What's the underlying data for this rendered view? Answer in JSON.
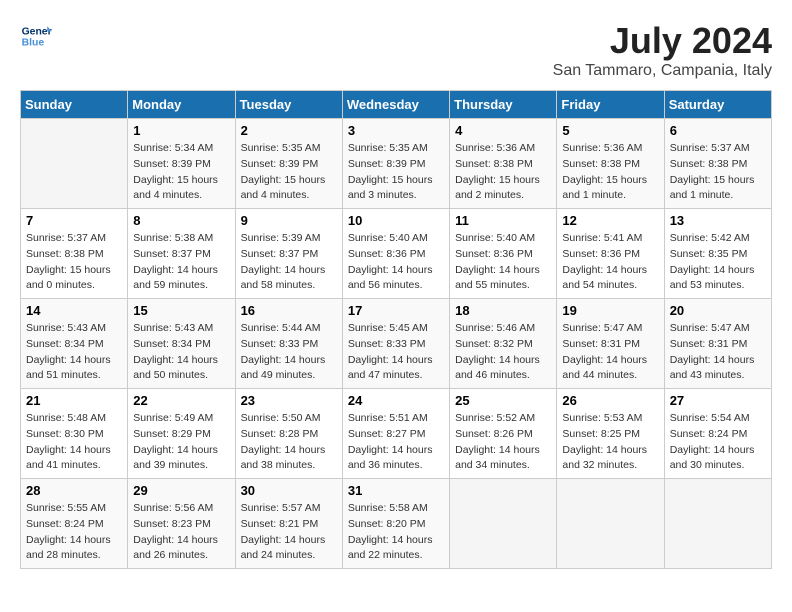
{
  "logo": {
    "line1": "General",
    "line2": "Blue"
  },
  "title": "July 2024",
  "location": "San Tammaro, Campania, Italy",
  "weekdays": [
    "Sunday",
    "Monday",
    "Tuesday",
    "Wednesday",
    "Thursday",
    "Friday",
    "Saturday"
  ],
  "weeks": [
    [
      {
        "day": "",
        "info": ""
      },
      {
        "day": "1",
        "info": "Sunrise: 5:34 AM\nSunset: 8:39 PM\nDaylight: 15 hours\nand 4 minutes."
      },
      {
        "day": "2",
        "info": "Sunrise: 5:35 AM\nSunset: 8:39 PM\nDaylight: 15 hours\nand 4 minutes."
      },
      {
        "day": "3",
        "info": "Sunrise: 5:35 AM\nSunset: 8:39 PM\nDaylight: 15 hours\nand 3 minutes."
      },
      {
        "day": "4",
        "info": "Sunrise: 5:36 AM\nSunset: 8:38 PM\nDaylight: 15 hours\nand 2 minutes."
      },
      {
        "day": "5",
        "info": "Sunrise: 5:36 AM\nSunset: 8:38 PM\nDaylight: 15 hours\nand 1 minute."
      },
      {
        "day": "6",
        "info": "Sunrise: 5:37 AM\nSunset: 8:38 PM\nDaylight: 15 hours\nand 1 minute."
      }
    ],
    [
      {
        "day": "7",
        "info": "Sunrise: 5:37 AM\nSunset: 8:38 PM\nDaylight: 15 hours\nand 0 minutes."
      },
      {
        "day": "8",
        "info": "Sunrise: 5:38 AM\nSunset: 8:37 PM\nDaylight: 14 hours\nand 59 minutes."
      },
      {
        "day": "9",
        "info": "Sunrise: 5:39 AM\nSunset: 8:37 PM\nDaylight: 14 hours\nand 58 minutes."
      },
      {
        "day": "10",
        "info": "Sunrise: 5:40 AM\nSunset: 8:36 PM\nDaylight: 14 hours\nand 56 minutes."
      },
      {
        "day": "11",
        "info": "Sunrise: 5:40 AM\nSunset: 8:36 PM\nDaylight: 14 hours\nand 55 minutes."
      },
      {
        "day": "12",
        "info": "Sunrise: 5:41 AM\nSunset: 8:36 PM\nDaylight: 14 hours\nand 54 minutes."
      },
      {
        "day": "13",
        "info": "Sunrise: 5:42 AM\nSunset: 8:35 PM\nDaylight: 14 hours\nand 53 minutes."
      }
    ],
    [
      {
        "day": "14",
        "info": "Sunrise: 5:43 AM\nSunset: 8:34 PM\nDaylight: 14 hours\nand 51 minutes."
      },
      {
        "day": "15",
        "info": "Sunrise: 5:43 AM\nSunset: 8:34 PM\nDaylight: 14 hours\nand 50 minutes."
      },
      {
        "day": "16",
        "info": "Sunrise: 5:44 AM\nSunset: 8:33 PM\nDaylight: 14 hours\nand 49 minutes."
      },
      {
        "day": "17",
        "info": "Sunrise: 5:45 AM\nSunset: 8:33 PM\nDaylight: 14 hours\nand 47 minutes."
      },
      {
        "day": "18",
        "info": "Sunrise: 5:46 AM\nSunset: 8:32 PM\nDaylight: 14 hours\nand 46 minutes."
      },
      {
        "day": "19",
        "info": "Sunrise: 5:47 AM\nSunset: 8:31 PM\nDaylight: 14 hours\nand 44 minutes."
      },
      {
        "day": "20",
        "info": "Sunrise: 5:47 AM\nSunset: 8:31 PM\nDaylight: 14 hours\nand 43 minutes."
      }
    ],
    [
      {
        "day": "21",
        "info": "Sunrise: 5:48 AM\nSunset: 8:30 PM\nDaylight: 14 hours\nand 41 minutes."
      },
      {
        "day": "22",
        "info": "Sunrise: 5:49 AM\nSunset: 8:29 PM\nDaylight: 14 hours\nand 39 minutes."
      },
      {
        "day": "23",
        "info": "Sunrise: 5:50 AM\nSunset: 8:28 PM\nDaylight: 14 hours\nand 38 minutes."
      },
      {
        "day": "24",
        "info": "Sunrise: 5:51 AM\nSunset: 8:27 PM\nDaylight: 14 hours\nand 36 minutes."
      },
      {
        "day": "25",
        "info": "Sunrise: 5:52 AM\nSunset: 8:26 PM\nDaylight: 14 hours\nand 34 minutes."
      },
      {
        "day": "26",
        "info": "Sunrise: 5:53 AM\nSunset: 8:25 PM\nDaylight: 14 hours\nand 32 minutes."
      },
      {
        "day": "27",
        "info": "Sunrise: 5:54 AM\nSunset: 8:24 PM\nDaylight: 14 hours\nand 30 minutes."
      }
    ],
    [
      {
        "day": "28",
        "info": "Sunrise: 5:55 AM\nSunset: 8:24 PM\nDaylight: 14 hours\nand 28 minutes."
      },
      {
        "day": "29",
        "info": "Sunrise: 5:56 AM\nSunset: 8:23 PM\nDaylight: 14 hours\nand 26 minutes."
      },
      {
        "day": "30",
        "info": "Sunrise: 5:57 AM\nSunset: 8:21 PM\nDaylight: 14 hours\nand 24 minutes."
      },
      {
        "day": "31",
        "info": "Sunrise: 5:58 AM\nSunset: 8:20 PM\nDaylight: 14 hours\nand 22 minutes."
      },
      {
        "day": "",
        "info": ""
      },
      {
        "day": "",
        "info": ""
      },
      {
        "day": "",
        "info": ""
      }
    ]
  ]
}
